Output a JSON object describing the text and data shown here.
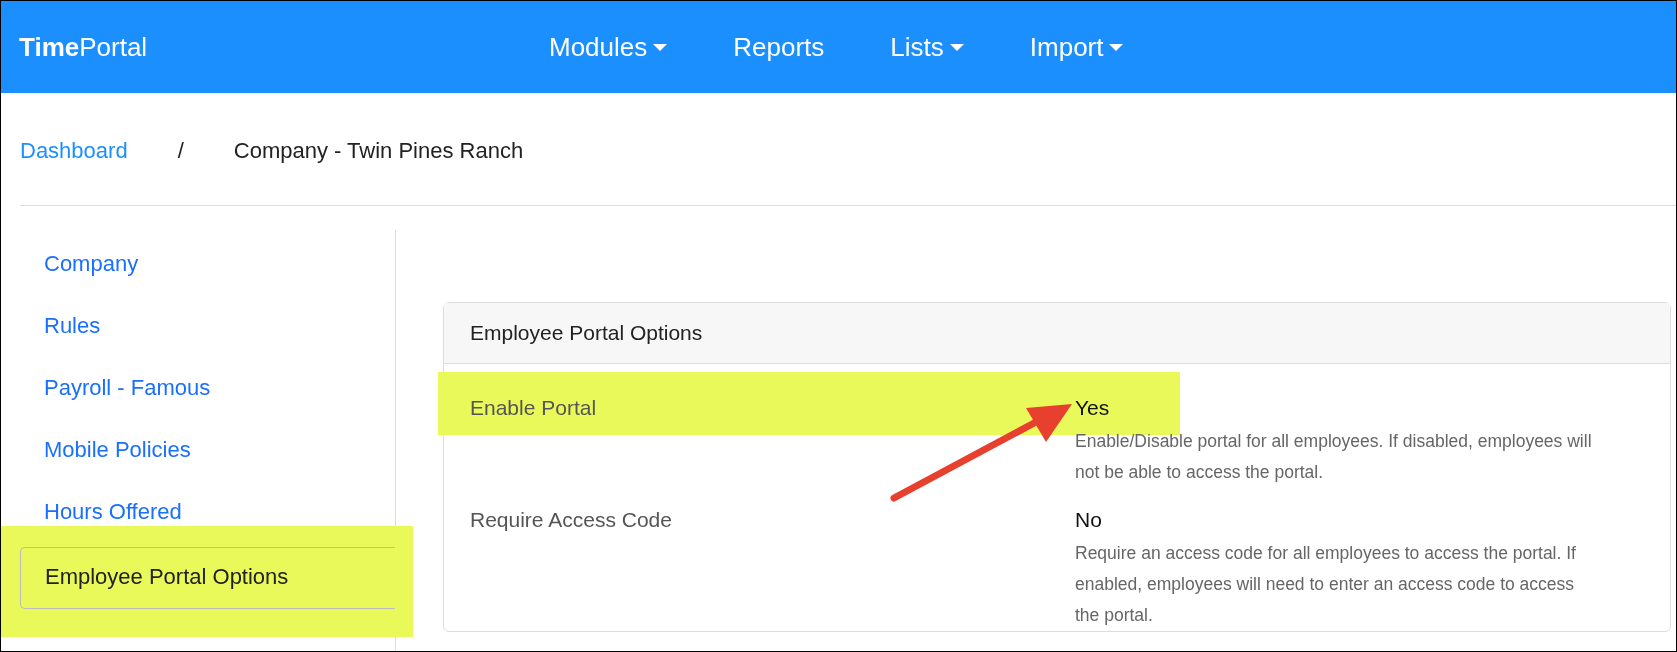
{
  "header": {
    "logo": "**Time**Portal",
    "nav": [
      {
        "label": "Modules",
        "dropdown": true
      },
      {
        "label": "Reports",
        "dropdown": false
      },
      {
        "label": "Lists",
        "dropdown": true
      },
      {
        "label": "Import",
        "dropdown": true
      }
    ]
  },
  "breadcrumb": {
    "separator": "/",
    "items": [
      {
        "label": "Dashboard",
        "link": true
      },
      {
        "label": "Company - Twin Pines Ranch",
        "link": false
      }
    ]
  },
  "sidebar": {
    "items": [
      {
        "label": "Company",
        "selected": false,
        "highlighted": false
      },
      {
        "label": "Rules",
        "selected": false,
        "highlighted": false
      },
      {
        "label": "Payroll - Famous",
        "selected": false,
        "highlighted": false
      },
      {
        "label": "Mobile Policies",
        "selected": false,
        "highlighted": false
      },
      {
        "label": "Hours Offered",
        "selected": false,
        "highlighted": false
      },
      {
        "label": "Employee Portal Options",
        "selected": true,
        "highlighted": true
      }
    ]
  },
  "panel": {
    "title": "Employee Portal Options",
    "rows": [
      {
        "label": "Enable Portal",
        "value": "Yes",
        "description": "Enable/Disable portal for all employees. If disabled, employees will not be able to access the portal.",
        "highlighted": true,
        "arrow": true
      },
      {
        "label": "Require Access Code",
        "value": "No",
        "description": "Require an access code for all employees to access the portal. If enabled, employees will need to enter an access code to access the portal.",
        "highlighted": false,
        "arrow": false
      }
    ]
  }
}
